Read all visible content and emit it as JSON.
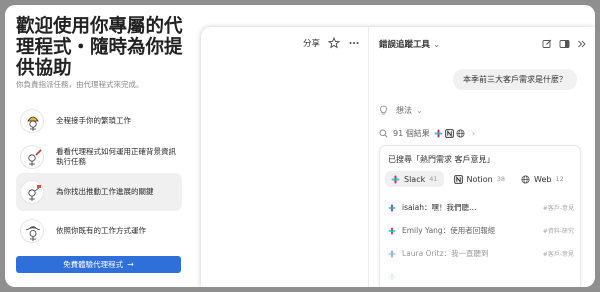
{
  "onboarding": {
    "title": "歡迎使用你專屬的代理程式・隨時為你提供協助",
    "subtitle": "你負責指派任務，由代理程式來完成。",
    "steps": [
      {
        "label": "全程接手你的繁瑣工作"
      },
      {
        "label": "看看代理程式如何運用正確背景資訊執行任務"
      },
      {
        "label": "為你找出推動工作進展的關鍵"
      },
      {
        "label": "依照你既有的工作方式運作"
      }
    ],
    "cta_label": "免費體驗代理程式"
  },
  "doc": {
    "share_label": "分享"
  },
  "sidebar": {
    "title": "錯誤追蹤工具",
    "user_message": "本季前三大客戶需求是什麼？",
    "thinking_label": "想法",
    "results_label": "91 個結果",
    "searched_label": "已搜尋「熱門需求 客戶意見」",
    "sources": [
      {
        "name": "Slack",
        "count": "41"
      },
      {
        "name": "Notion",
        "count": "38"
      },
      {
        "name": "Web",
        "count": "12"
      }
    ],
    "messages": [
      {
        "text": "isaiah：嘿！我們聽…",
        "tag": "#客戶-意見"
      },
      {
        "text": "Emily Yang：使用者回報經",
        "tag": "#資料-研究"
      },
      {
        "text": "Laura Oritz：我一直聽到",
        "tag": "#客戶-意見"
      },
      {
        "text": "",
        "tag": ""
      }
    ]
  },
  "colors": {
    "accent": "#2e6fd9",
    "backdrop": "#8f8f8f"
  }
}
